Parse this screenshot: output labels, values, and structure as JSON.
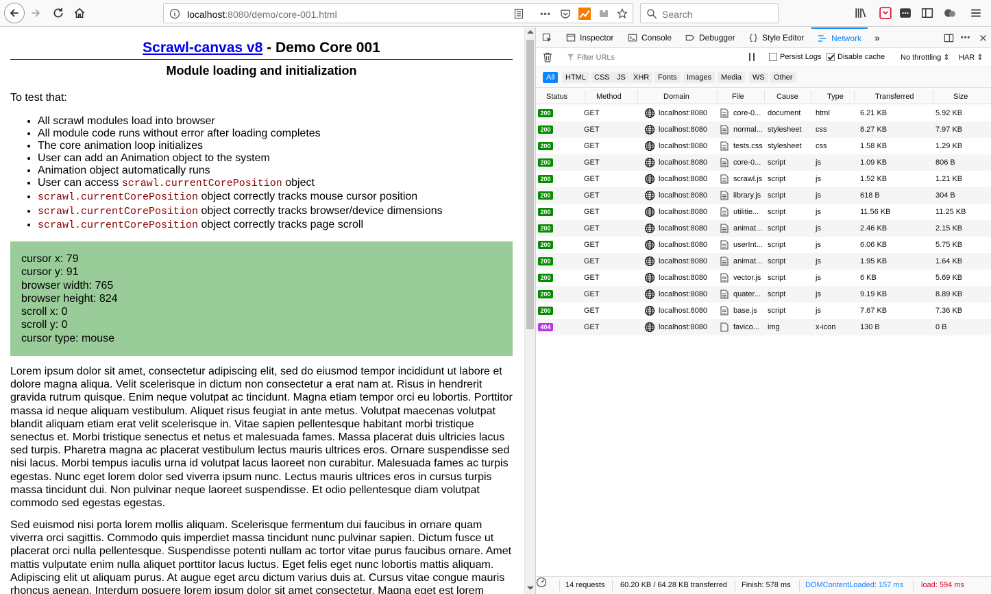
{
  "browser": {
    "url_host": "localhost",
    "url_rest": ":8080/demo/core-001.html",
    "search_placeholder": "Search"
  },
  "page": {
    "title_link": "Scrawl-canvas v8",
    "title_rest": " - Demo Core 001",
    "subtitle": "Module loading and initialization",
    "intro": "To test that:",
    "bullets": [
      {
        "text": "All scrawl modules load into browser"
      },
      {
        "text": "All module code runs without error after loading completes"
      },
      {
        "text": "The core animation loop initializes"
      },
      {
        "text": "User can add an Animation object to the system"
      },
      {
        "text": "Animation object automatically runs"
      },
      {
        "pre": "User can access ",
        "code": "scrawl.currentCorePosition",
        "post": " object"
      },
      {
        "pre": "",
        "code": "scrawl.currentCorePosition",
        "post": " object correctly tracks mouse cursor position"
      },
      {
        "pre": "",
        "code": "scrawl.currentCorePosition",
        "post": " object correctly tracks browser/device dimensions"
      },
      {
        "pre": "",
        "code": "scrawl.currentCorePosition",
        "post": " object correctly tracks page scroll"
      }
    ],
    "readout": [
      "cursor x: 79",
      "cursor y: 91",
      "browser width: 765",
      "browser height: 824",
      "scroll x: 0",
      "scroll y: 0",
      "cursor type: mouse"
    ],
    "lorem1": "Lorem ipsum dolor sit amet, consectetur adipiscing elit, sed do eiusmod tempor incididunt ut labore et dolore magna aliqua. Velit scelerisque in dictum non consectetur a erat nam at. Risus in hendrerit gravida rutrum quisque. Enim neque volutpat ac tincidunt. Magna etiam tempor orci eu lobortis. Porttitor massa id neque aliquam vestibulum. Aliquet risus feugiat in ante metus. Volutpat maecenas volutpat blandit aliquam etiam erat velit scelerisque in. Vitae sapien pellentesque habitant morbi tristique senectus et. Morbi tristique senectus et netus et malesuada fames. Massa placerat duis ultricies lacus sed turpis. Pharetra magna ac placerat vestibulum lectus mauris ultrices eros. Ornare suspendisse sed nisi lacus. Morbi tempus iaculis urna id volutpat lacus laoreet non curabitur. Malesuada fames ac turpis egestas. Nunc eget lorem dolor sed viverra ipsum nunc. Lectus mauris ultrices eros in cursus turpis massa tincidunt dui. Non pulvinar neque laoreet suspendisse. Et odio pellentesque diam volutpat commodo sed egestas egestas.",
    "lorem2": "Sed euismod nisi porta lorem mollis aliquam. Scelerisque fermentum dui faucibus in ornare quam viverra orci sagittis. Commodo quis imperdiet massa tincidunt nunc pulvinar sapien. Dictum fusce ut placerat orci nulla pellentesque. Suspendisse potenti nullam ac tortor vitae purus faucibus ornare. Amet mattis vulputate enim nulla aliquet porttitor lacus luctus. Eget felis eget nunc lobortis mattis aliquam. Adipiscing elit ut aliquam purus. At augue eget arcu dictum varius duis at. Cursus vitae congue mauris rhoncus aenean. Interdum posuere lorem ipsum dolor sit amet consectetur. Magna eget est lorem"
  },
  "devtools": {
    "tabs": [
      "Inspector",
      "Console",
      "Debugger",
      "Style Editor",
      "Network"
    ],
    "active_tab": "Network",
    "filter_placeholder": "Filter URLs",
    "persist_logs": "Persist Logs",
    "disable_cache": "Disable cache",
    "throttling": "No throttling",
    "har": "HAR",
    "types": [
      "All",
      "HTML",
      "CSS",
      "JS",
      "XHR",
      "Fonts",
      "Images",
      "Media",
      "WS",
      "Other"
    ],
    "columns": [
      "Status",
      "Method",
      "Domain",
      "File",
      "Cause",
      "Type",
      "Transferred",
      "Size"
    ],
    "requests": [
      {
        "status": "200",
        "method": "GET",
        "domain": "localhost:8080",
        "file": "core-0...",
        "cause": "document",
        "type": "html",
        "transferred": "6.21 KB",
        "size": "5.92 KB"
      },
      {
        "status": "200",
        "method": "GET",
        "domain": "localhost:8080",
        "file": "normal...",
        "cause": "stylesheet",
        "type": "css",
        "transferred": "8.27 KB",
        "size": "7.97 KB"
      },
      {
        "status": "200",
        "method": "GET",
        "domain": "localhost:8080",
        "file": "tests.css",
        "cause": "stylesheet",
        "type": "css",
        "transferred": "1.58 KB",
        "size": "1.29 KB"
      },
      {
        "status": "200",
        "method": "GET",
        "domain": "localhost:8080",
        "file": "core-0...",
        "cause": "script",
        "type": "js",
        "transferred": "1.09 KB",
        "size": "806 B"
      },
      {
        "status": "200",
        "method": "GET",
        "domain": "localhost:8080",
        "file": "scrawl.js",
        "cause": "script",
        "type": "js",
        "transferred": "1.52 KB",
        "size": "1.21 KB"
      },
      {
        "status": "200",
        "method": "GET",
        "domain": "localhost:8080",
        "file": "library.js",
        "cause": "script",
        "type": "js",
        "transferred": "618 B",
        "size": "304 B"
      },
      {
        "status": "200",
        "method": "GET",
        "domain": "localhost:8080",
        "file": "utilitie...",
        "cause": "script",
        "type": "js",
        "transferred": "11.56 KB",
        "size": "11.25 KB"
      },
      {
        "status": "200",
        "method": "GET",
        "domain": "localhost:8080",
        "file": "animat...",
        "cause": "script",
        "type": "js",
        "transferred": "2.46 KB",
        "size": "2.15 KB"
      },
      {
        "status": "200",
        "method": "GET",
        "domain": "localhost:8080",
        "file": "userInt...",
        "cause": "script",
        "type": "js",
        "transferred": "6.06 KB",
        "size": "5.75 KB"
      },
      {
        "status": "200",
        "method": "GET",
        "domain": "localhost:8080",
        "file": "animat...",
        "cause": "script",
        "type": "js",
        "transferred": "1.95 KB",
        "size": "1.64 KB"
      },
      {
        "status": "200",
        "method": "GET",
        "domain": "localhost:8080",
        "file": "vector.js",
        "cause": "script",
        "type": "js",
        "transferred": "6 KB",
        "size": "5.69 KB"
      },
      {
        "status": "200",
        "method": "GET",
        "domain": "localhost:8080",
        "file": "quater...",
        "cause": "script",
        "type": "js",
        "transferred": "9.19 KB",
        "size": "8.89 KB"
      },
      {
        "status": "200",
        "method": "GET",
        "domain": "localhost:8080",
        "file": "base.js",
        "cause": "script",
        "type": "js",
        "transferred": "7.67 KB",
        "size": "7.36 KB"
      },
      {
        "status": "404",
        "method": "GET",
        "domain": "localhost:8080",
        "file": "favico...",
        "cause": "img",
        "type": "x-icon",
        "transferred": "130 B",
        "size": "0 B"
      }
    ],
    "summary": {
      "requests": "14 requests",
      "transferred": "60.20 KB / 64.28 KB transferred",
      "finish": "Finish: 578 ms",
      "dcl": "DOMContentLoaded: 157 ms",
      "load": "load: 594 ms"
    },
    "colors": {
      "accent": "#0a84ff",
      "ok": "#058b00",
      "notfound": "#b43ae7",
      "dcl": "#0a84ff",
      "load": "#d70022"
    }
  }
}
